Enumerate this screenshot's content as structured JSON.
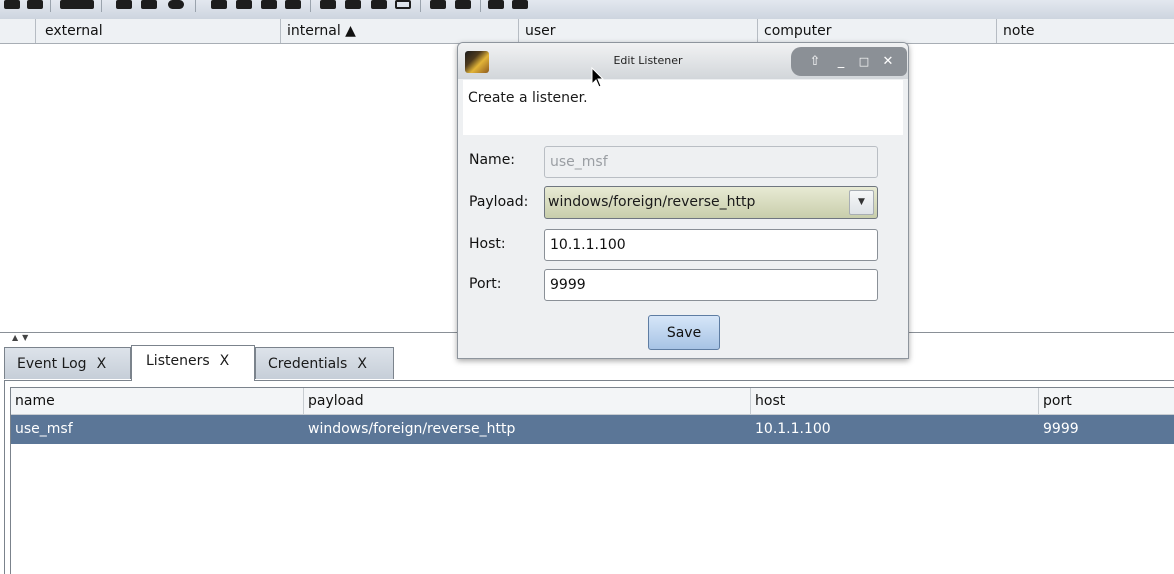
{
  "toolbar": {
    "icons": [
      "new-connection-icon",
      "disconnect-icon",
      "targets-icon",
      "graph-icon",
      "list-icon",
      "crosshair-icon",
      "console-icon",
      "download-icon",
      "key-icon",
      "screenshot-icon",
      "settings-icon",
      "coffee-icon",
      "log-icon",
      "script-icon",
      "link-icon",
      "server-icon",
      "book-icon",
      "cube-icon"
    ]
  },
  "targets_table": {
    "columns": [
      "",
      "external",
      "internal ▲",
      "user",
      "computer",
      "note"
    ]
  },
  "tabs": [
    {
      "label": "Event Log",
      "close": "X"
    },
    {
      "label": "Listeners",
      "close": "X"
    },
    {
      "label": "Credentials",
      "close": "X"
    }
  ],
  "listeners_table": {
    "columns": [
      "name",
      "payload",
      "host",
      "port"
    ],
    "rows": [
      {
        "name": "use_msf",
        "payload": "windows/foreign/reverse_http",
        "host": "10.1.1.100",
        "port": "9999"
      }
    ]
  },
  "dialog": {
    "title": "Edit Listener",
    "message": "Create a listener.",
    "name_label": "Name:",
    "name_value": "use_msf",
    "payload_label": "Payload:",
    "payload_value": "windows/foreign/reverse_http",
    "host_label": "Host:",
    "host_value": "10.1.1.100",
    "port_label": "Port:",
    "port_value": "9999",
    "save_label": "Save"
  },
  "colors": {
    "selected_row": "#5b7697",
    "dialog_controls": "#8b9096",
    "save_button": "#a7c3e5",
    "payload_select": "#c8ceab"
  }
}
